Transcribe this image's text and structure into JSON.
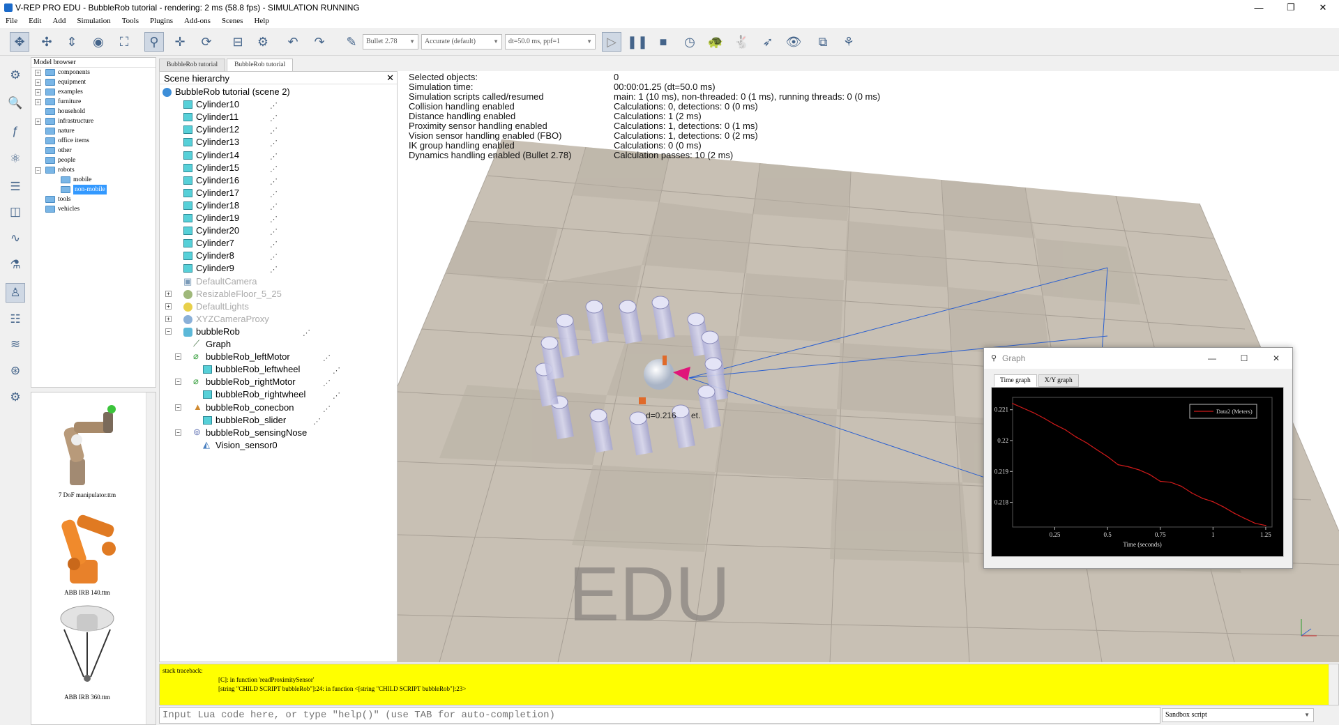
{
  "window": {
    "title": "V-REP PRO EDU - BubbleRob tutorial - rendering: 2 ms (58.8 fps) - SIMULATION RUNNING",
    "minimize": "—",
    "maximize": "❐",
    "close": "✕"
  },
  "menu": [
    "File",
    "Edit",
    "Add",
    "Simulation",
    "Tools",
    "Plugins",
    "Add-ons",
    "Scenes",
    "Help"
  ],
  "toolbar": {
    "engine": "Bullet 2.78",
    "accuracy": "Accurate (default)",
    "timestep": "dt=50.0 ms, ppf=1"
  },
  "model_browser": {
    "header": "Model browser",
    "items": [
      {
        "label": "components",
        "expandable": true,
        "level": 0
      },
      {
        "label": "equipment",
        "expandable": true,
        "level": 0
      },
      {
        "label": "examples",
        "expandable": true,
        "level": 0
      },
      {
        "label": "furniture",
        "expandable": true,
        "level": 0
      },
      {
        "label": "household",
        "expandable": false,
        "level": 0
      },
      {
        "label": "infrastructure",
        "expandable": true,
        "level": 0
      },
      {
        "label": "nature",
        "expandable": false,
        "level": 0
      },
      {
        "label": "office items",
        "expandable": false,
        "level": 0
      },
      {
        "label": "other",
        "expandable": false,
        "level": 0
      },
      {
        "label": "people",
        "expandable": false,
        "level": 0
      },
      {
        "label": "robots",
        "expandable": true,
        "level": 0
      },
      {
        "label": "mobile",
        "expandable": false,
        "level": 1
      },
      {
        "label": "non-mobile",
        "expandable": false,
        "level": 1,
        "selected": true
      },
      {
        "label": "tools",
        "expandable": false,
        "level": 0
      },
      {
        "label": "vehicles",
        "expandable": false,
        "level": 0
      }
    ],
    "thumbnails": [
      "7 DoF manipulator.ttm",
      "ABB IRB 140.ttm",
      "ABB IRB 360.ttm"
    ]
  },
  "scene_tabs": [
    "BubbleRob tutorial",
    "BubbleRob tutorial"
  ],
  "hierarchy": {
    "title": "Scene hierarchy",
    "close": "✕",
    "root": "BubbleRob tutorial (scene 2)",
    "cylinders": [
      "Cylinder10",
      "Cylinder11",
      "Cylinder12",
      "Cylinder13",
      "Cylinder14",
      "Cylinder15",
      "Cylinder16",
      "Cylinder17",
      "Cylinder18",
      "Cylinder19",
      "Cylinder20",
      "Cylinder7",
      "Cylinder8",
      "Cylinder9"
    ],
    "dim_items": [
      "DefaultCamera",
      "ResizableFloor_5_25",
      "DefaultLights",
      "XYZCameraProxy"
    ],
    "robot": "bubbleRob",
    "children": [
      "Graph",
      "bubbleRob_leftMotor",
      "bubbleRob_leftwheel",
      "bubbleRob_rightMotor",
      "bubbleRob_rightwheel",
      "bubbleRob_conecbon",
      "bubbleRob_slider",
      "bubbleRob_sensingNose",
      "Vision_sensor0"
    ]
  },
  "sim_info": {
    "labels": [
      "Selected objects:",
      "Simulation time:",
      "Simulation scripts called/resumed",
      "Collision handling enabled",
      "Distance handling enabled",
      "Proximity sensor handling enabled",
      "Vision sensor handling enabled (FBO)",
      "IK group handling enabled",
      "Dynamics handling enabled (Bullet 2.78)"
    ],
    "values": [
      "0",
      "00:00:01.25 (dt=50.0 ms)",
      "main: 1 (10 ms), non-threaded: 0 (1 ms), running threads: 0 (0 ms)",
      "Calculations: 0, detections: 0 (0 ms)",
      "Calculations: 1 (2 ms)",
      "Calculations: 1, detections: 0 (1 ms)",
      "Calculations: 1, detections: 0 (2 ms)",
      "Calculations: 0 (0 ms)",
      "Calculation passes: 10 (2 ms)"
    ]
  },
  "viewport": {
    "watermark": "EDU",
    "label": "d=0.216",
    "label2": "et."
  },
  "graph_window": {
    "title": "Graph",
    "tabs": [
      "Time graph",
      "X/Y graph"
    ],
    "legend": "Data2 (Meters)",
    "xlabel": "Time (seconds)"
  },
  "chart_data": {
    "type": "line",
    "xlabel": "Time (seconds)",
    "ylabel": "",
    "xlim": [
      0.05,
      1.28
    ],
    "ylim": [
      0.2172,
      0.2214
    ],
    "xticks": [
      "0.25",
      "0.5",
      "0.75",
      "1",
      "1.25"
    ],
    "yticks": [
      "0.221",
      "0.22",
      "0.219",
      "0.218"
    ],
    "series": [
      {
        "name": "Data2 (Meters)",
        "color": "#d01a1a",
        "x": [
          0.05,
          0.1,
          0.15,
          0.2,
          0.25,
          0.3,
          0.35,
          0.4,
          0.45,
          0.5,
          0.55,
          0.6,
          0.65,
          0.7,
          0.75,
          0.8,
          0.85,
          0.9,
          0.95,
          1.0,
          1.05,
          1.1,
          1.15,
          1.2,
          1.25
        ],
        "y": [
          0.2212,
          0.22105,
          0.2209,
          0.22072,
          0.22052,
          0.22035,
          0.22012,
          0.21993,
          0.2197,
          0.21948,
          0.21922,
          0.21915,
          0.21905,
          0.2189,
          0.21868,
          0.21865,
          0.21852,
          0.2183,
          0.21813,
          0.21802,
          0.21785,
          0.21765,
          0.21748,
          0.21732,
          0.21725
        ]
      }
    ],
    "grid": false,
    "legend": "top-right",
    "background": "#000000"
  },
  "console": {
    "lines": [
      "stack traceback:",
      "[C]: in function 'readProximitySensor'",
      "[string \"CHILD SCRIPT bubbleRob\"]:24: in function <[string \"CHILD SCRIPT bubbleRob\"]:23>"
    ]
  },
  "command": {
    "placeholder": "Input Lua code here, or type \"help()\" (use TAB for auto-completion)",
    "sandbox": "Sandbox script"
  }
}
